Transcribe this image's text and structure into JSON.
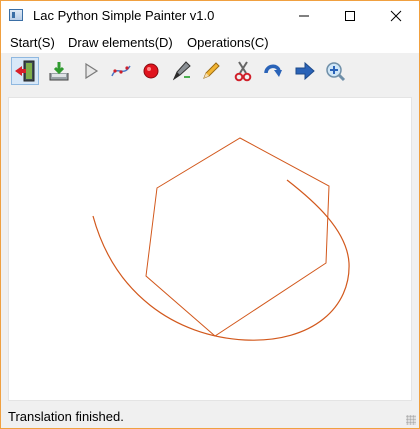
{
  "window": {
    "title": "Lac Python Simple Painter v1.0",
    "app_icon": "window-app-icon",
    "controls": [
      "minimize-icon",
      "maximize-icon",
      "close-icon"
    ]
  },
  "menu": {
    "start": "Start(S)",
    "draw": "Draw elements(D)",
    "operations": "Operations(C)"
  },
  "toolbar": {
    "icons": [
      "exit-icon",
      "save-icon",
      "play-icon",
      "curve-icon",
      "record-icon",
      "pen-icon",
      "pencil-icon",
      "scissors-icon",
      "rotate-icon",
      "arrow-right-icon",
      "zoom-in-icon"
    ],
    "active_tool": "exit-icon"
  },
  "canvas": {
    "stroke_color": "#d2581c",
    "background": "#ffffff",
    "shapes": [
      "hexagon",
      "curve"
    ]
  },
  "status": {
    "text": "Translation finished."
  }
}
